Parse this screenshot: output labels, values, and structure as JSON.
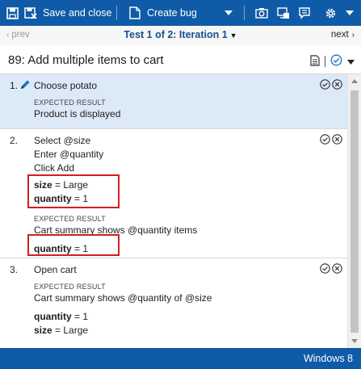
{
  "toolbar": {
    "save_label": "Save and close",
    "create_bug_label": "Create bug"
  },
  "nav": {
    "prev_label": "prev",
    "title": "Test 1 of 2: Iteration 1",
    "next_label": "next"
  },
  "test_case": {
    "title": "89: Add multiple items to cart"
  },
  "expected_result_label": "EXPECTED RESULT",
  "steps": [
    {
      "number": "1.",
      "action": "Choose potato",
      "expected": "Product is displayed"
    },
    {
      "number": "2.",
      "action_lines": [
        "Select @size",
        "Enter @quantity",
        "Click Add"
      ],
      "params": [
        {
          "name": "size",
          "eq": " = ",
          "value": "Large"
        },
        {
          "name": "quantity",
          "eq": " = ",
          "value": "1"
        }
      ],
      "expected": "Cart summary shows @quantity items",
      "expected_params": [
        {
          "name": "quantity",
          "eq": " = ",
          "value": "1"
        }
      ]
    },
    {
      "number": "3.",
      "action": "Open cart",
      "expected": "Cart summary shows @quantity of @size",
      "expected_params": [
        {
          "name": "quantity",
          "eq": " = ",
          "value": "1"
        },
        {
          "name": "size",
          "eq": " = ",
          "value": "Large"
        }
      ]
    }
  ],
  "status": {
    "text": "Windows 8"
  },
  "colors": {
    "accent": "#0f5ba8",
    "active_step": "#dce9f7",
    "highlight_box": "#d11f1f"
  }
}
